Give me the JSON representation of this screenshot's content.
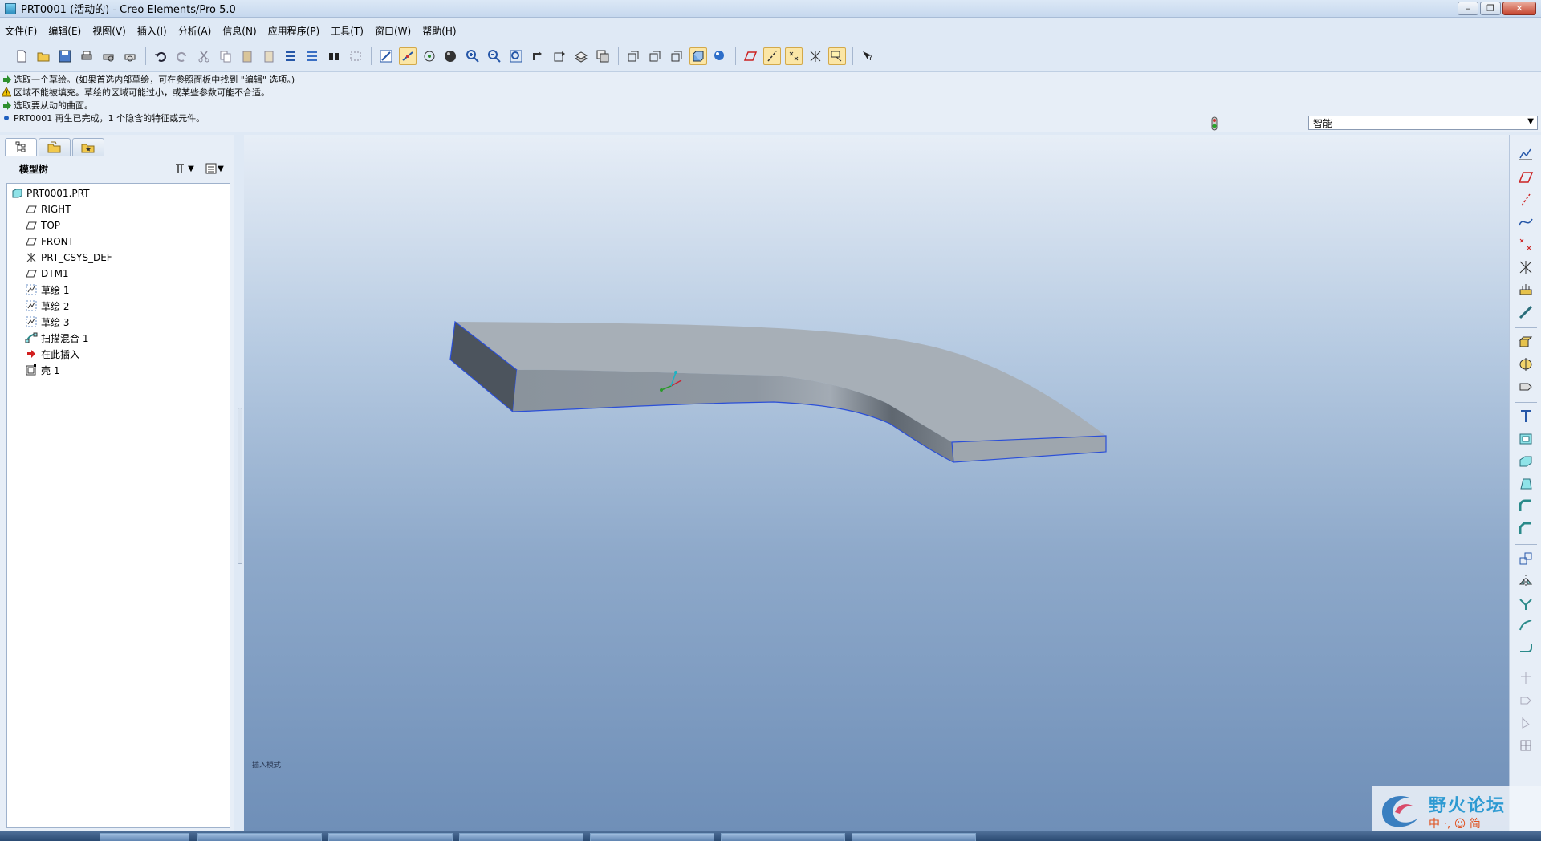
{
  "window": {
    "title": "PRT0001 (活动的) - Creo Elements/Pro 5.0",
    "minimize": "–",
    "maximize": "❐",
    "close": "✕"
  },
  "menubar": [
    "文件(F)",
    "编辑(E)",
    "视图(V)",
    "插入(I)",
    "分析(A)",
    "信息(N)",
    "应用程序(P)",
    "工具(T)",
    "窗口(W)",
    "帮助(H)"
  ],
  "messages": [
    {
      "icon": "arrow-icon",
      "color": "#2d8f2d",
      "text": "选取一个草绘。(如果首选内部草绘，可在参照面板中找到 \"编辑\" 选项。)"
    },
    {
      "icon": "warning-icon",
      "color": "#e6b800",
      "text": "区域不能被填充。草绘的区域可能过小，或某些参数可能不合适。"
    },
    {
      "icon": "arrow-icon",
      "color": "#2d8f2d",
      "text": "选取要从动的曲面。"
    },
    {
      "icon": "dot-icon",
      "color": "#1f5fbf",
      "text": "PRT0001 再生已完成，1 个隐含的特征或元件。"
    }
  ],
  "filter": {
    "selected": "智能"
  },
  "navpanel": {
    "title": "模型树",
    "tree": [
      {
        "label": "PRT0001.PRT",
        "icon": "part-icon",
        "level": 0
      },
      {
        "label": "RIGHT",
        "icon": "datum-plane-icon",
        "level": 1
      },
      {
        "label": "TOP",
        "icon": "datum-plane-icon",
        "level": 1
      },
      {
        "label": "FRONT",
        "icon": "datum-plane-icon",
        "level": 1
      },
      {
        "label": "PRT_CSYS_DEF",
        "icon": "csys-icon",
        "level": 1
      },
      {
        "label": "DTM1",
        "icon": "datum-plane-icon",
        "level": 1
      },
      {
        "label": "草绘 1",
        "icon": "sketch-icon",
        "level": 1
      },
      {
        "label": "草绘 2",
        "icon": "sketch-icon",
        "level": 1
      },
      {
        "label": "草绘 3",
        "icon": "sketch-icon",
        "level": 1
      },
      {
        "label": "扫描混合 1",
        "icon": "swept-blend-icon",
        "level": 1
      },
      {
        "label": "在此插入",
        "icon": "insert-here-icon",
        "level": 1
      },
      {
        "label": "壳 1",
        "icon": "shell-icon",
        "level": 1
      }
    ]
  },
  "viewport": {
    "mode_label": "插入模式"
  },
  "watermark": {
    "title": "野火论坛",
    "subtitle": "中 ·, ☺ 简"
  },
  "colors": {
    "accent": "#2d9ad2",
    "model_face_top": "#a8b0b8",
    "model_edge": "#2b4fd8"
  }
}
